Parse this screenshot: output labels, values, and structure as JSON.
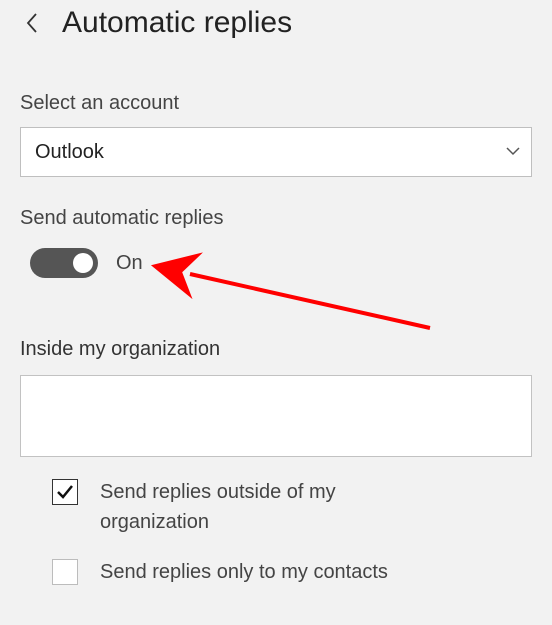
{
  "header": {
    "back_icon": "chevron-left",
    "title": "Automatic replies"
  },
  "account_section": {
    "label": "Select an account",
    "selected": "Outlook",
    "options": [
      "Outlook"
    ]
  },
  "auto_reply": {
    "label": "Send automatic replies",
    "enabled": true,
    "state_text": "On"
  },
  "inside_org": {
    "label": "Inside my organization",
    "message": ""
  },
  "outside_org": {
    "send_outside": {
      "checked": true,
      "label": "Send replies outside of my organization"
    },
    "only_contacts": {
      "checked": false,
      "label": "Send replies only to my contacts"
    }
  },
  "annotation": {
    "arrow_color": "#ff0000"
  }
}
